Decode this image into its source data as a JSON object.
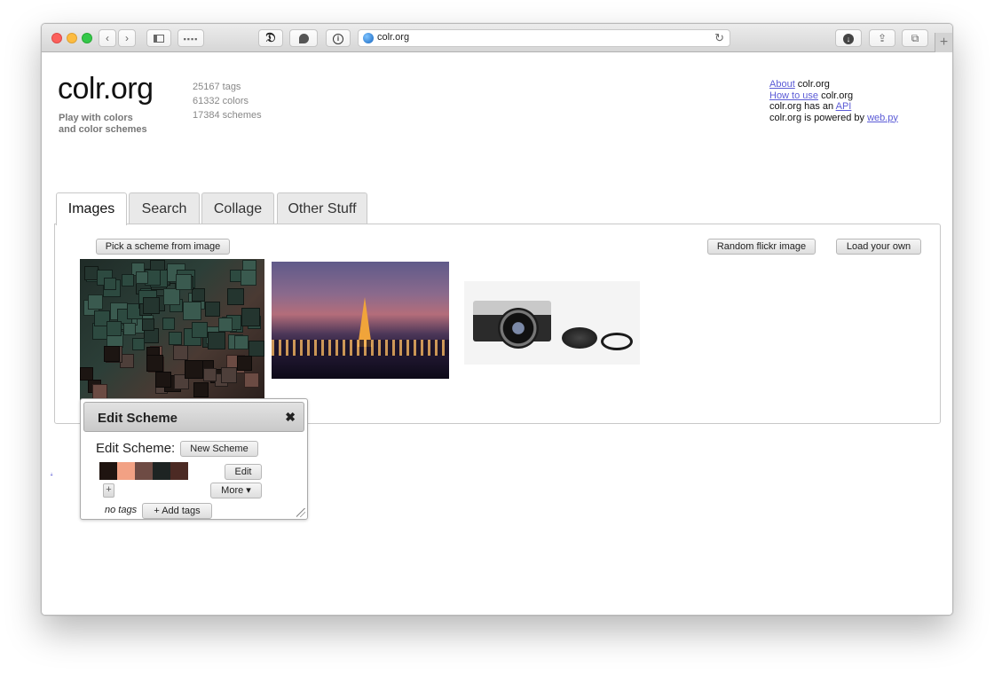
{
  "browser": {
    "url": "colr.org"
  },
  "site": {
    "logo": "colr.org",
    "tagline_1": "Play with colors",
    "tagline_2": "and color schemes",
    "stats": [
      "25167 tags",
      "61332 colors",
      "17384 schemes"
    ],
    "about": {
      "line1_link": "About",
      "line1_text": " colr.org",
      "line2_link": "How to use",
      "line2_text": " colr.org",
      "line3_text": "colr.org has an ",
      "line3_link": "API",
      "line4_text": "colr.org is powered by ",
      "line4_link": "web.py"
    }
  },
  "tabs": [
    "Images",
    "Search",
    "Collage",
    "Other Stuff"
  ],
  "images_panel": {
    "pick_button": "Pick a scheme from image",
    "random_button": "Random flickr image",
    "load_button": "Load your own"
  },
  "small_link": ".",
  "edit_dialog": {
    "title": "Edit Scheme",
    "close": "✖",
    "label": "Edit Scheme:",
    "new_scheme_button": "New Scheme",
    "edit_button": "Edit",
    "more_button": "More ▾",
    "plus": "+",
    "no_tags": "no tags",
    "add_tags_button": "+ Add tags",
    "swatch_colors": [
      "#1f1410",
      "#f2a184",
      "#6e4b44",
      "#1e2423",
      "#4c2a24"
    ]
  },
  "toolbar_icons": [
    "back-icon",
    "forward-icon",
    "sidebar-icon",
    "grid-icon",
    "extension-d-icon",
    "extension-bird-icon",
    "password-icon",
    "download-icon",
    "share-icon",
    "tabs-icon"
  ]
}
